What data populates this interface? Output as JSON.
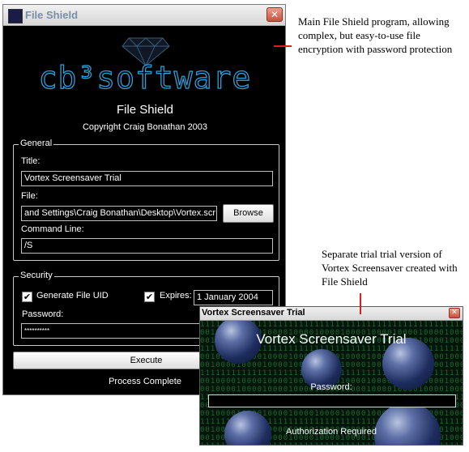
{
  "main_window": {
    "title": "File Shield",
    "close_glyph": "✕",
    "icon": "app-icon",
    "logo_text": "cb³software",
    "app_name": "File Shield",
    "copyright": "Copyright Craig Bonathan 2003",
    "general": {
      "legend": "General",
      "title_label": "Title:",
      "title_value": "Vortex Screensaver Trial",
      "file_label": "File:",
      "file_value": "and Settings\\Craig Bonathan\\Desktop\\Vortex.scr",
      "browse_label": "Browse",
      "command_label": "Command Line:",
      "command_value": "/S"
    },
    "security": {
      "legend": "Security",
      "generate_uid_label": "Generate File UID",
      "generate_uid_checked": true,
      "expires_label": "Expires:",
      "expires_checked": true,
      "expires_value": "1 January 2004",
      "password_label": "Password:",
      "password_value": "**********",
      "check_glyph": "✔"
    },
    "execute_label": "Execute",
    "status": "Process Complete"
  },
  "trial_window": {
    "title": "Vortex Screensaver Trial",
    "close_glyph": "✕",
    "heading": "Vortex Screensaver Trial",
    "password_label": "Password:",
    "password_value": "",
    "status": "Authorization Required"
  },
  "annotations": {
    "main": "Main File Shield program, allowing complex, but easy-to-use file encryption with password protection",
    "trial": "Separate trial trial version of Vortex Screensaver created with File Shield"
  },
  "colors": {
    "window_background": "#000000",
    "logo_accent": "#2f9fd8",
    "annotation_pointer": "#e21c1c",
    "matrix_green": "#186a2f"
  }
}
